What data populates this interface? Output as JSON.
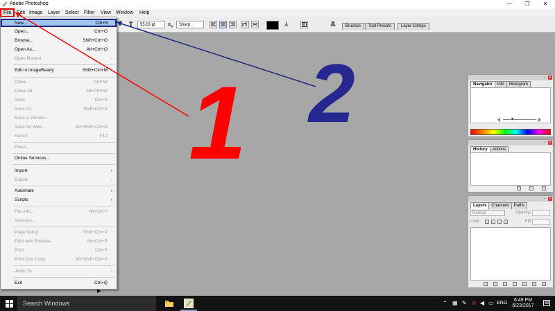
{
  "window": {
    "title": "Adobe Photoshop",
    "controls": {
      "minimize": "—",
      "restore": "❐",
      "close": "✕"
    }
  },
  "menubar": {
    "items": [
      "File",
      "Edit",
      "Image",
      "Layer",
      "Select",
      "Filter",
      "View",
      "Window",
      "Help"
    ]
  },
  "options_bar": {
    "font_size": "55.63 pt",
    "aa_prefix": "a",
    "aa_sub": "a",
    "anti_alias": "Sharp",
    "palette_tabs": [
      "Brushes",
      "Tool Presets",
      "Layer Comps"
    ]
  },
  "file_menu": {
    "items": [
      {
        "label": "New...",
        "shortcut": "Ctrl+N",
        "state": "highlighted"
      },
      {
        "label": "Open...",
        "shortcut": "Ctrl+O",
        "state": "enabled"
      },
      {
        "label": "Browse...",
        "shortcut": "Shift+Ctrl+O",
        "state": "enabled"
      },
      {
        "label": "Open As...",
        "shortcut": "Alt+Ctrl+O",
        "state": "enabled"
      },
      {
        "label": "Open Recent",
        "submenu": true,
        "state": "disabled"
      },
      {
        "label": "Edit in ImageReady",
        "shortcut": "Shift+Ctrl+M",
        "state": "enabled"
      },
      {
        "label": "Close",
        "shortcut": "Ctrl+W",
        "state": "disabled"
      },
      {
        "label": "Close All",
        "shortcut": "Alt+Ctrl+W",
        "state": "disabled"
      },
      {
        "label": "Save",
        "shortcut": "Ctrl+S",
        "state": "disabled"
      },
      {
        "label": "Save As...",
        "shortcut": "Shift+Ctrl+S",
        "state": "disabled"
      },
      {
        "label": "Save a Version...",
        "state": "disabled"
      },
      {
        "label": "Save for Web...",
        "shortcut": "Alt+Shift+Ctrl+S",
        "state": "disabled"
      },
      {
        "label": "Revert",
        "shortcut": "F12",
        "state": "disabled"
      },
      {
        "label": "Place...",
        "state": "disabled"
      },
      {
        "label": "Online Services...",
        "state": "enabled"
      },
      {
        "label": "Import",
        "submenu": true,
        "state": "enabled"
      },
      {
        "label": "Export",
        "submenu": true,
        "state": "disabled"
      },
      {
        "label": "Automate",
        "submenu": true,
        "state": "enabled"
      },
      {
        "label": "Scripts",
        "submenu": true,
        "state": "enabled"
      },
      {
        "label": "File Info...",
        "shortcut": "Alt+Ctrl+I",
        "state": "disabled"
      },
      {
        "label": "Versions...",
        "state": "disabled"
      },
      {
        "label": "Page Setup...",
        "shortcut": "Shift+Ctrl+P",
        "state": "disabled"
      },
      {
        "label": "Print with Preview...",
        "shortcut": "Alt+Ctrl+P",
        "state": "disabled"
      },
      {
        "label": "Print...",
        "shortcut": "Ctrl+P",
        "state": "disabled"
      },
      {
        "label": "Print One Copy",
        "shortcut": "Alt+Shift+Ctrl+P",
        "state": "disabled"
      },
      {
        "label": "Jump To",
        "submenu": true,
        "state": "disabled"
      },
      {
        "label": "Exit",
        "shortcut": "Ctrl+Q",
        "state": "enabled"
      }
    ],
    "submenu_arrow": "›"
  },
  "panels": {
    "navigator": {
      "tabs": [
        "Navigator",
        "Info",
        "Histogram"
      ]
    },
    "history": {
      "tabs": [
        "History",
        "Actions"
      ]
    },
    "layers": {
      "tabs": [
        "Layers",
        "Channels",
        "Paths"
      ],
      "blend_mode": "Normal",
      "opacity_label": "Opacity:",
      "lock_label": "Lock:",
      "fill_label": "Fill:"
    }
  },
  "annotations": {
    "label_1": "1",
    "label_2": "2",
    "color_1": "#ff0000",
    "color_2": "#27288f"
  },
  "taskbar": {
    "search_placeholder": "Search Windows",
    "language": "ENG",
    "time": "6:49 PM",
    "date": "6/23/2017"
  }
}
